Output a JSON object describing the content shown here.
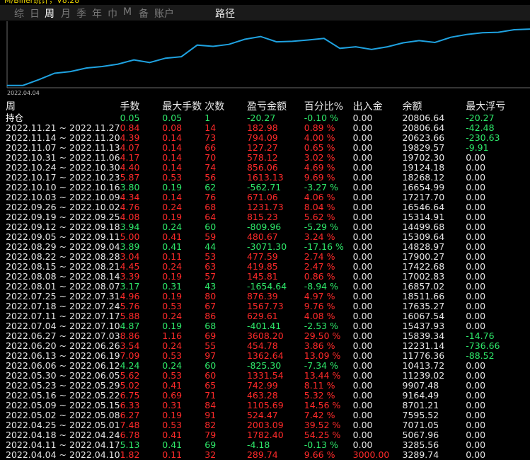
{
  "title_fragment": "M/Bilier统计，V8.28",
  "tabs": [
    {
      "label": "综",
      "active": false
    },
    {
      "label": "日",
      "active": false
    },
    {
      "label": "周",
      "active": true
    },
    {
      "label": "月",
      "active": false
    },
    {
      "label": "季",
      "active": false
    },
    {
      "label": "年",
      "active": false
    },
    {
      "label": "巾",
      "active": false
    },
    {
      "label": "M",
      "active": false
    },
    {
      "label": "备",
      "active": false
    },
    {
      "label": "账户",
      "active": false
    }
  ],
  "path_label": "路径",
  "chart": {
    "start_date": "2022.04.04",
    "line_color": "#1fa2e0"
  },
  "chart_data": {
    "type": "line",
    "x": [
      "2022.04.04",
      "2022.04.11",
      "2022.04.18",
      "2022.04.25",
      "2022.05.02",
      "2022.05.09",
      "2022.05.16",
      "2022.05.23",
      "2022.05.30",
      "2022.06.06",
      "2022.06.13",
      "2022.06.20",
      "2022.06.27",
      "2022.07.04",
      "2022.07.11",
      "2022.07.18",
      "2022.07.25",
      "2022.08.01",
      "2022.08.08",
      "2022.08.15",
      "2022.08.22",
      "2022.08.29",
      "2022.09.05",
      "2022.09.12",
      "2022.09.19",
      "2022.09.26",
      "2022.10.03",
      "2022.10.10",
      "2022.10.17",
      "2022.10.24",
      "2022.10.31",
      "2022.11.07",
      "2022.11.14",
      "2022.11.21"
    ],
    "values": [
      3289.74,
      3285.56,
      5067.96,
      7071.05,
      7595.52,
      8701.21,
      9164.49,
      9907.48,
      11239.02,
      10413.72,
      11776.36,
      12231.14,
      15839.34,
      15437.93,
      16067.54,
      17635.27,
      18511.66,
      16857.02,
      17002.83,
      17422.68,
      17900.27,
      14828.97,
      15309.64,
      14499.68,
      15314.91,
      16546.64,
      17217.7,
      16654.99,
      18268.12,
      19124.18,
      19702.3,
      19829.57,
      20623.66,
      20806.64
    ]
  },
  "table": {
    "headers": [
      "周",
      "手数",
      "最大手数",
      "次数",
      "盈亏金额",
      "百分比%",
      "出入金",
      "余额",
      "最大浮亏"
    ],
    "holding_label": "持仓",
    "holding": {
      "lots": "0.05",
      "max_lots": "0.05",
      "count": "1",
      "pnl": "-20.27",
      "pct": "-0.10 %",
      "flow": "0.00",
      "balance": "20806.64",
      "max_float": "-20.27"
    },
    "rows": [
      {
        "week": "2022.11.21 ~ 2022.11.27",
        "lots": "0.84",
        "max_lots": "0.08",
        "count": "14",
        "pnl": "182.98",
        "pct": "0.89 %",
        "flow": "0.00",
        "balance": "20806.64",
        "max_float": "-42.48",
        "color": "r",
        "mf_color": "g"
      },
      {
        "week": "2022.11.14 ~ 2022.11.20",
        "lots": "4.39",
        "max_lots": "0.14",
        "count": "73",
        "pnl": "794.09",
        "pct": "4.00 %",
        "flow": "0.00",
        "balance": "20623.66",
        "max_float": "-230.63",
        "color": "r",
        "mf_color": "g"
      },
      {
        "week": "2022.11.07 ~ 2022.11.13",
        "lots": "4.07",
        "max_lots": "0.14",
        "count": "66",
        "pnl": "127.27",
        "pct": "0.65 %",
        "flow": "0.00",
        "balance": "19829.57",
        "max_float": "-9.91",
        "color": "r",
        "mf_color": "g"
      },
      {
        "week": "2022.10.31 ~ 2022.11.06",
        "lots": "4.17",
        "max_lots": "0.14",
        "count": "70",
        "pnl": "578.12",
        "pct": "3.02 %",
        "flow": "0.00",
        "balance": "19702.30",
        "max_float": "0.00",
        "color": "r",
        "mf_color": "n"
      },
      {
        "week": "2022.10.24 ~ 2022.10.30",
        "lots": "4.40",
        "max_lots": "0.14",
        "count": "74",
        "pnl": "856.06",
        "pct": "4.69 %",
        "flow": "0.00",
        "balance": "19124.18",
        "max_float": "0.00",
        "color": "r",
        "mf_color": "n"
      },
      {
        "week": "2022.10.17 ~ 2022.10.23",
        "lots": "5.87",
        "max_lots": "0.53",
        "count": "56",
        "pnl": "1613.13",
        "pct": "9.69 %",
        "flow": "0.00",
        "balance": "18268.12",
        "max_float": "0.00",
        "color": "r",
        "mf_color": "n"
      },
      {
        "week": "2022.10.10 ~ 2022.10.16",
        "lots": "3.80",
        "max_lots": "0.19",
        "count": "62",
        "pnl": "-562.71",
        "pct": "-3.27 %",
        "flow": "0.00",
        "balance": "16654.99",
        "max_float": "0.00",
        "color": "g",
        "mf_color": "n"
      },
      {
        "week": "2022.10.03 ~ 2022.10.09",
        "lots": "4.34",
        "max_lots": "0.14",
        "count": "76",
        "pnl": "671.06",
        "pct": "4.06 %",
        "flow": "0.00",
        "balance": "17217.70",
        "max_float": "0.00",
        "color": "r",
        "mf_color": "n"
      },
      {
        "week": "2022.09.26 ~ 2022.10.02",
        "lots": "4.76",
        "max_lots": "0.24",
        "count": "68",
        "pnl": "1231.73",
        "pct": "8.04 %",
        "flow": "0.00",
        "balance": "16546.64",
        "max_float": "0.00",
        "color": "r",
        "mf_color": "n"
      },
      {
        "week": "2022.09.19 ~ 2022.09.25",
        "lots": "4.08",
        "max_lots": "0.19",
        "count": "64",
        "pnl": "815.23",
        "pct": "5.62 %",
        "flow": "0.00",
        "balance": "15314.91",
        "max_float": "0.00",
        "color": "r",
        "mf_color": "n"
      },
      {
        "week": "2022.09.12 ~ 2022.09.18",
        "lots": "3.94",
        "max_lots": "0.24",
        "count": "60",
        "pnl": "-809.96",
        "pct": "-5.29 %",
        "flow": "0.00",
        "balance": "14499.68",
        "max_float": "0.00",
        "color": "g",
        "mf_color": "n"
      },
      {
        "week": "2022.09.05 ~ 2022.09.11",
        "lots": "5.00",
        "max_lots": "0.41",
        "count": "59",
        "pnl": "480.67",
        "pct": "3.24 %",
        "flow": "0.00",
        "balance": "15309.64",
        "max_float": "0.00",
        "color": "r",
        "mf_color": "n"
      },
      {
        "week": "2022.08.29 ~ 2022.09.04",
        "lots": "3.89",
        "max_lots": "0.41",
        "count": "44",
        "pnl": "-3071.30",
        "pct": "-17.16 %",
        "flow": "0.00",
        "balance": "14828.97",
        "max_float": "0.00",
        "color": "g",
        "mf_color": "n"
      },
      {
        "week": "2022.08.22 ~ 2022.08.28",
        "lots": "3.04",
        "max_lots": "0.11",
        "count": "53",
        "pnl": "477.59",
        "pct": "2.74 %",
        "flow": "0.00",
        "balance": "17900.27",
        "max_float": "0.00",
        "color": "r",
        "mf_color": "n"
      },
      {
        "week": "2022.08.15 ~ 2022.08.21",
        "lots": "4.45",
        "max_lots": "0.24",
        "count": "63",
        "pnl": "419.85",
        "pct": "2.47 %",
        "flow": "0.00",
        "balance": "17422.68",
        "max_float": "0.00",
        "color": "r",
        "mf_color": "n"
      },
      {
        "week": "2022.08.08 ~ 2022.08.14",
        "lots": "3.39",
        "max_lots": "0.19",
        "count": "57",
        "pnl": "145.81",
        "pct": "0.86 %",
        "flow": "0.00",
        "balance": "17002.83",
        "max_float": "0.00",
        "color": "r",
        "mf_color": "n"
      },
      {
        "week": "2022.08.01 ~ 2022.08.07",
        "lots": "3.17",
        "max_lots": "0.31",
        "count": "43",
        "pnl": "-1654.64",
        "pct": "-8.94 %",
        "flow": "0.00",
        "balance": "16857.02",
        "max_float": "0.00",
        "color": "g",
        "mf_color": "n"
      },
      {
        "week": "2022.07.25 ~ 2022.07.31",
        "lots": "4.96",
        "max_lots": "0.19",
        "count": "80",
        "pnl": "876.39",
        "pct": "4.97 %",
        "flow": "0.00",
        "balance": "18511.66",
        "max_float": "0.00",
        "color": "r",
        "mf_color": "n"
      },
      {
        "week": "2022.07.18 ~ 2022.07.24",
        "lots": "5.76",
        "max_lots": "0.53",
        "count": "67",
        "pnl": "1567.73",
        "pct": "9.76 %",
        "flow": "0.00",
        "balance": "17635.27",
        "max_float": "0.00",
        "color": "r",
        "mf_color": "n"
      },
      {
        "week": "2022.07.11 ~ 2022.07.17",
        "lots": "5.88",
        "max_lots": "0.24",
        "count": "86",
        "pnl": "629.61",
        "pct": "4.08 %",
        "flow": "0.00",
        "balance": "16067.54",
        "max_float": "0.00",
        "color": "r",
        "mf_color": "n"
      },
      {
        "week": "2022.07.04 ~ 2022.07.10",
        "lots": "4.87",
        "max_lots": "0.19",
        "count": "68",
        "pnl": "-401.41",
        "pct": "-2.53 %",
        "flow": "0.00",
        "balance": "15437.93",
        "max_float": "0.00",
        "color": "g",
        "mf_color": "n"
      },
      {
        "week": "2022.06.27 ~ 2022.07.03",
        "lots": "8.86",
        "max_lots": "1.16",
        "count": "69",
        "pnl": "3608.20",
        "pct": "29.50 %",
        "flow": "0.00",
        "balance": "15839.34",
        "max_float": "-14.76",
        "color": "r",
        "mf_color": "g"
      },
      {
        "week": "2022.06.20 ~ 2022.06.26",
        "lots": "3.54",
        "max_lots": "0.24",
        "count": "55",
        "pnl": "454.78",
        "pct": "3.86 %",
        "flow": "0.00",
        "balance": "12231.14",
        "max_float": "-736.66",
        "color": "r",
        "mf_color": "g"
      },
      {
        "week": "2022.06.13 ~ 2022.06.19",
        "lots": "7.09",
        "max_lots": "0.53",
        "count": "97",
        "pnl": "1362.64",
        "pct": "13.09 %",
        "flow": "0.00",
        "balance": "11776.36",
        "max_float": "-88.52",
        "color": "r",
        "mf_color": "g"
      },
      {
        "week": "2022.06.06 ~ 2022.06.12",
        "lots": "4.24",
        "max_lots": "0.24",
        "count": "60",
        "pnl": "-825.30",
        "pct": "-7.34 %",
        "flow": "0.00",
        "balance": "10413.72",
        "max_float": "0.00",
        "color": "g",
        "mf_color": "n"
      },
      {
        "week": "2022.05.30 ~ 2022.06.05",
        "lots": "5.62",
        "max_lots": "0.53",
        "count": "60",
        "pnl": "1331.54",
        "pct": "13.44 %",
        "flow": "0.00",
        "balance": "11239.02",
        "max_float": "0.00",
        "color": "r",
        "mf_color": "n"
      },
      {
        "week": "2022.05.23 ~ 2022.05.29",
        "lots": "5.02",
        "max_lots": "0.41",
        "count": "65",
        "pnl": "742.99",
        "pct": "8.11 %",
        "flow": "0.00",
        "balance": "9907.48",
        "max_float": "0.00",
        "color": "r",
        "mf_color": "n"
      },
      {
        "week": "2022.05.16 ~ 2022.05.22",
        "lots": "6.75",
        "max_lots": "0.69",
        "count": "71",
        "pnl": "463.28",
        "pct": "5.32 %",
        "flow": "0.00",
        "balance": "9164.49",
        "max_float": "0.00",
        "color": "r",
        "mf_color": "n"
      },
      {
        "week": "2022.05.09 ~ 2022.05.15",
        "lots": "6.33",
        "max_lots": "0.31",
        "count": "84",
        "pnl": "1105.69",
        "pct": "14.56 %",
        "flow": "0.00",
        "balance": "8701.21",
        "max_float": "0.00",
        "color": "r",
        "mf_color": "n"
      },
      {
        "week": "2022.05.02 ~ 2022.05.08",
        "lots": "6.27",
        "max_lots": "0.19",
        "count": "91",
        "pnl": "524.47",
        "pct": "7.42 %",
        "flow": "0.00",
        "balance": "7595.52",
        "max_float": "0.00",
        "color": "r",
        "mf_color": "n"
      },
      {
        "week": "2022.04.25 ~ 2022.05.01",
        "lots": "7.48",
        "max_lots": "0.53",
        "count": "82",
        "pnl": "2003.09",
        "pct": "39.52 %",
        "flow": "0.00",
        "balance": "7071.05",
        "max_float": "0.00",
        "color": "r",
        "mf_color": "n"
      },
      {
        "week": "2022.04.18 ~ 2022.04.24",
        "lots": "6.78",
        "max_lots": "0.41",
        "count": "79",
        "pnl": "1782.40",
        "pct": "54.25 %",
        "flow": "0.00",
        "balance": "5067.96",
        "max_float": "0.00",
        "color": "r",
        "mf_color": "n"
      },
      {
        "week": "2022.04.11 ~ 2022.04.17",
        "lots": "5.13",
        "max_lots": "0.41",
        "count": "69",
        "pnl": "-4.18",
        "pct": "-0.13 %",
        "flow": "0.00",
        "balance": "3285.56",
        "max_float": "0.00",
        "color": "g",
        "mf_color": "n"
      },
      {
        "week": "2022.04.04 ~ 2022.04.10",
        "lots": "1.82",
        "max_lots": "0.11",
        "count": "32",
        "pnl": "289.74",
        "pct": "9.66 %",
        "flow": "3000.00",
        "balance": "3289.74",
        "max_float": "0.00",
        "color": "r",
        "mf_color": "n",
        "flow_color": "r"
      }
    ]
  }
}
